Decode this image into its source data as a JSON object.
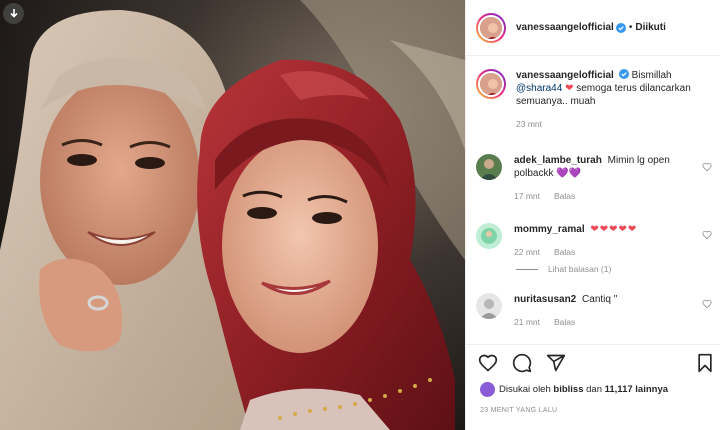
{
  "post": {
    "author": "vanessaangelofficial",
    "follow_status": "Diikuti",
    "dot": "•"
  },
  "caption": {
    "user": "vanessaangelofficial",
    "text_1": "Bismillah",
    "mention": "@shara44",
    "heart": "❤",
    "text_2": "semoga terus dilancarkan semuanya.. muah",
    "time": "23 mnt"
  },
  "comments": [
    {
      "user": "adek_lambe_turah",
      "text": "Mimin lg open polbackk",
      "emoji": "💜💜",
      "time": "17 mnt",
      "reply_label": "Balas",
      "avatar_color": "#5a7d4e"
    },
    {
      "user": "mommy_ramal",
      "text": "",
      "emoji": "❤❤❤❤❤",
      "time": "22 mnt",
      "reply_label": "Balas",
      "avatar_color": "#7fd3a8",
      "view_replies": "Lihat balasan (1)"
    },
    {
      "user": "nuritasusan2",
      "text": "Cantiq \"",
      "emoji": "",
      "time": "21 mnt",
      "reply_label": "Balas",
      "avatar_color": "#d9d9d9"
    }
  ],
  "likes": {
    "prefix": "Disukai oleh",
    "first_user": "bibliss",
    "middle": "dan",
    "count": "11,117 lainnya"
  },
  "timestamp": "23 MENIT YANG LALU",
  "icons": [
    "download-icon",
    "verified-badge-icon",
    "heart-icon",
    "comment-icon",
    "share-icon",
    "bookmark-icon"
  ],
  "colors": {
    "verified": "#3897f0",
    "hijab_red": "#8e1f24",
    "hijab_beige": "#c9b8a6",
    "heart": "#ed4956",
    "purple_heart": "#8a5bd6"
  }
}
